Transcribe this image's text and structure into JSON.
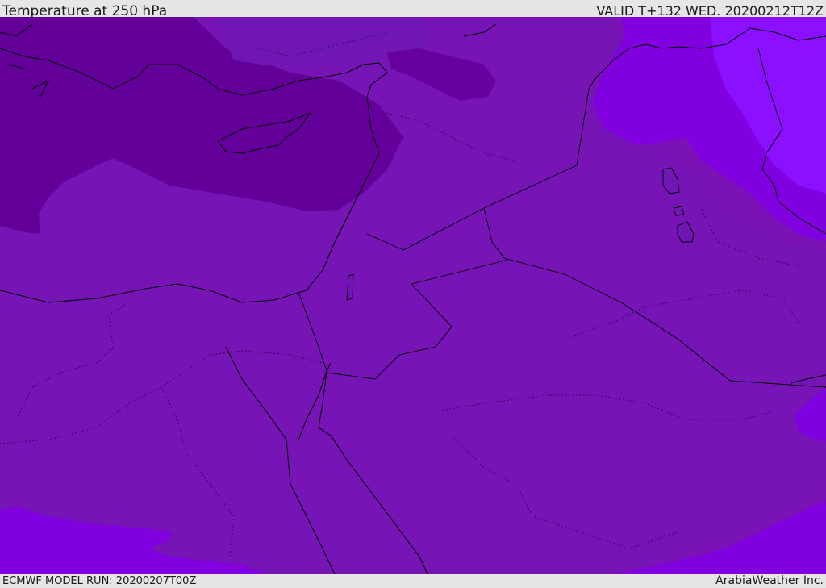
{
  "header": {
    "title": "Temperature at 250 hPa",
    "valid": "VALID T+132 WED. 20200212T12Z"
  },
  "footer": {
    "model_run": "ECMWF MODEL RUN: 20200207T00Z",
    "brand": "ArabiaWeather Inc."
  },
  "map": {
    "colors": {
      "dark_purple": "#64009a",
      "mid_purple": "#7010b8",
      "base_purple": "#7a12b6",
      "violet": "#8000e0",
      "bright_violet": "#8a10ff",
      "blue_violet": "#7a00ff",
      "coastline": "#000000"
    }
  }
}
